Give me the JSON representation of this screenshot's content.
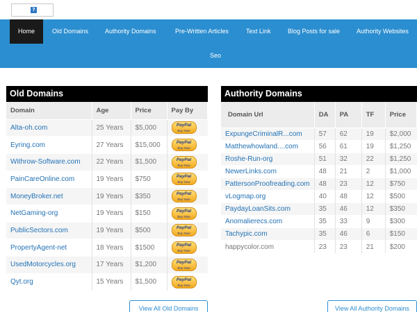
{
  "logo": {
    "icon": "?"
  },
  "nav": {
    "items": [
      {
        "label": "Home"
      },
      {
        "label": "Old Domains"
      },
      {
        "label": "Authority Domains"
      },
      {
        "label": "Pre-Written Articles"
      },
      {
        "label": "Text Link"
      },
      {
        "label": "Blog Posts for sale"
      },
      {
        "label": "Authority Websites"
      },
      {
        "label": "Seo"
      }
    ]
  },
  "old_domains": {
    "title": "Old Domains",
    "headers": {
      "domain": "Domain",
      "age": "Age",
      "price": "Price",
      "payby": "Pay By"
    },
    "paypal": {
      "top": "PayPal",
      "bottom": "Buy Now"
    },
    "rows": [
      {
        "domain": "Alta-oh.com",
        "age": "25 Years",
        "price": "$5,000"
      },
      {
        "domain": "Eyring.com",
        "age": "27 Years",
        "price": "$15,000"
      },
      {
        "domain": "Withrow-Software.com",
        "age": "22 Years",
        "price": "$1,500"
      },
      {
        "domain": "PainCareOnline.com",
        "age": "19 Years",
        "price": "$750"
      },
      {
        "domain": "MoneyBroker.net",
        "age": "19 Years",
        "price": "$350"
      },
      {
        "domain": "NetGaming-org",
        "age": "19 Years",
        "price": "$150"
      },
      {
        "domain": "PublicSectors.com",
        "age": "19 Years",
        "price": "$500"
      },
      {
        "domain": "PropertyAgent-net",
        "age": "18 Years",
        "price": "$1500"
      },
      {
        "domain": "UsedMotorcycles.org",
        "age": "17 Years",
        "price": "$1,200"
      },
      {
        "domain": "Qyt.org",
        "age": "15 Years",
        "price": "$1,500"
      }
    ],
    "view_all": "View All Old Domains"
  },
  "authority_domains": {
    "title": "Authority Domains",
    "headers": {
      "url": "Domain Url",
      "da": "DA",
      "pa": "PA",
      "tf": "TF",
      "price": "Price"
    },
    "rows": [
      {
        "url": "ExpungeCriminalR...com",
        "da": "57",
        "pa": "62",
        "tf": "19",
        "price": "$2,000"
      },
      {
        "url": "Matthewhowland....com",
        "da": "56",
        "pa": "61",
        "tf": "19",
        "price": "$1,250"
      },
      {
        "url": "Roshe-Run-org",
        "da": "51",
        "pa": "32",
        "tf": "22",
        "price": "$1,250"
      },
      {
        "url": "NewerLinks.com",
        "da": "48",
        "pa": "21",
        "tf": "2",
        "price": "$1,000"
      },
      {
        "url": "PattersonProofreading.com",
        "da": "48",
        "pa": "23",
        "tf": "12",
        "price": "$750"
      },
      {
        "url": "vLogmap.org",
        "da": "40",
        "pa": "48",
        "tf": "12",
        "price": "$500"
      },
      {
        "url": "PaydayLoanSits.com",
        "da": "35",
        "pa": "46",
        "tf": "12",
        "price": "$350"
      },
      {
        "url": "Anomalierecs.com",
        "da": "35",
        "pa": "33",
        "tf": "9",
        "price": "$300"
      },
      {
        "url": "Tachypic.com",
        "da": "35",
        "pa": "46",
        "tf": "6",
        "price": "$150"
      },
      {
        "url": "happycolor.com",
        "da": "23",
        "pa": "23",
        "tf": "21",
        "price": "$200"
      }
    ],
    "view_all": "View All Authority Domains"
  },
  "colors": {
    "nav_bg": "#2b8ed0",
    "nav_active": "#1a1a1a",
    "link": "#2472b5",
    "panel_title_bg": "#000000"
  }
}
